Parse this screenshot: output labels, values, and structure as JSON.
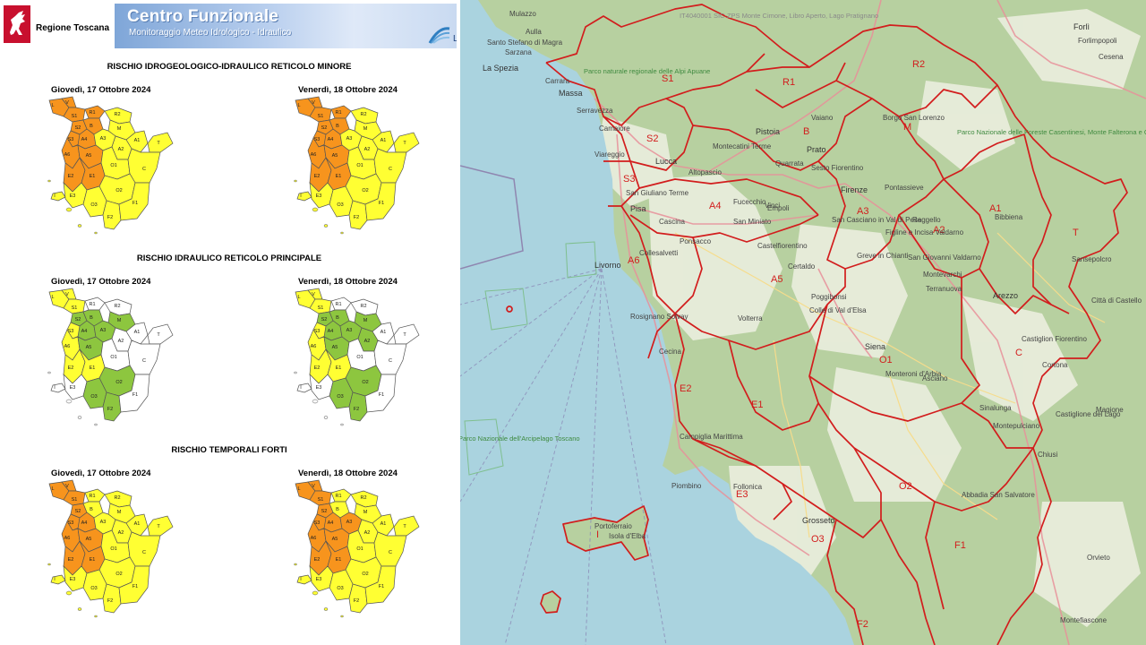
{
  "header": {
    "region_name": "Regione Toscana",
    "title": "Centro Funzionale",
    "subtitle": "Monitoraggio Meteo Idrologico - Idraulico",
    "logo_text": "La"
  },
  "colors": {
    "orange": "#f7941d",
    "yellow": "#ffff33",
    "green": "#8dc63f",
    "white": "#ffffff",
    "zone_line": "#d21d1d",
    "sea": "#aad3df"
  },
  "sections": [
    {
      "title": "RISCHIO IDROGEOLOGICO-IDRAULICO RETICOLO MINORE",
      "days": [
        {
          "date": "Giovedì, 17 Ottobre 2024",
          "coloring": "warn"
        },
        {
          "date": "Venerdì, 18 Ottobre 2024",
          "coloring": "warn"
        }
      ]
    },
    {
      "title": "RISCHIO IDRAULICO RETICOLO PRINCIPALE",
      "days": [
        {
          "date": "Giovedì, 17 Ottobre 2024",
          "coloring": "river1"
        },
        {
          "date": "Venerdì, 18 Ottobre 2024",
          "coloring": "river2"
        }
      ]
    },
    {
      "title": "RISCHIO TEMPORALI FORTI",
      "days": [
        {
          "date": "Giovedì, 17 Ottobre 2024",
          "coloring": "storm1"
        },
        {
          "date": "Venerdì, 18 Ottobre 2024",
          "coloring": "storm2"
        }
      ]
    }
  ],
  "small_map_zone_labels": [
    "L",
    "V",
    "S1",
    "S2",
    "S3",
    "R1",
    "R2",
    "B",
    "M",
    "A3",
    "A4",
    "A5",
    "A6",
    "A1",
    "A2",
    "T",
    "O1",
    "O2",
    "O3",
    "E1",
    "E2",
    "E3",
    "C",
    "F1",
    "F2",
    "I"
  ],
  "map_zones": [
    "S1",
    "R1",
    "R2",
    "B",
    "M",
    "S2",
    "S3",
    "A4",
    "A3",
    "A1",
    "A2",
    "T",
    "A6",
    "A5",
    "O1",
    "C",
    "E2",
    "E1",
    "E3",
    "O2",
    "O3",
    "F1",
    "F2",
    "I"
  ],
  "towns": [
    "La Spezia",
    "Sarzana",
    "Carrara",
    "Massa",
    "Serravezza",
    "Camaiore",
    "Viareggio",
    "Lucca",
    "Pistoia",
    "Prato",
    "Montecatini Terme",
    "Quarrata",
    "Sesto Fiorentino",
    "Firenze",
    "Pontassieve",
    "Borgo San Lorenzo",
    "Vaiano",
    "Altopascio",
    "Fucecchio",
    "Vinci",
    "San Giuliano Terme",
    "Pisa",
    "Cascina",
    "Empoli",
    "San Miniato",
    "Ponsacco",
    "Castelfiorentino",
    "San Casciano in Val di Pesa",
    "Reggello",
    "Figline e Incisa Valdarno",
    "Greve in Chianti",
    "Livorno",
    "Collesalvetti",
    "Certaldo",
    "Poggibonsi",
    "Colle di Val d'Elsa",
    "Rosignano Solvay",
    "Volterra",
    "Cecina",
    "Siena",
    "Monteroni d'Arbia",
    "Asciano",
    "Arezzo",
    "Castiglion Fiorentino",
    "Cortona",
    "Bibbiena",
    "Sansepolcro",
    "Città di Castello",
    "Campiglia Marittima",
    "Piombino",
    "Follonica",
    "Grosseto",
    "Portoferraio",
    "Isola d'Elba",
    "Montepulciano",
    "Abbadia San Salvatore",
    "Sinalunga",
    "Castiglione del Lago",
    "Magione",
    "Chiusi",
    "Orvieto",
    "Montefiascone",
    "Forlì",
    "Forlimpopoli",
    "Cesena",
    "Aulla",
    "Santo Stefano di Magra",
    "Montevarchi",
    "San Giovanni Valdarno",
    "Mulazzo",
    "Terranuova"
  ],
  "park_labels": [
    "Parco naturale regionale delle Alpi Apuane",
    "Parco Nazionale delle Foreste Casentinesi, Monte Falterona e Campigna",
    "Parco Nazionale dell'Arcipelago Toscano",
    "IT4040001 SIC-ZPS Monte Cimone, Libro Aperto, Lago Pratignano"
  ]
}
